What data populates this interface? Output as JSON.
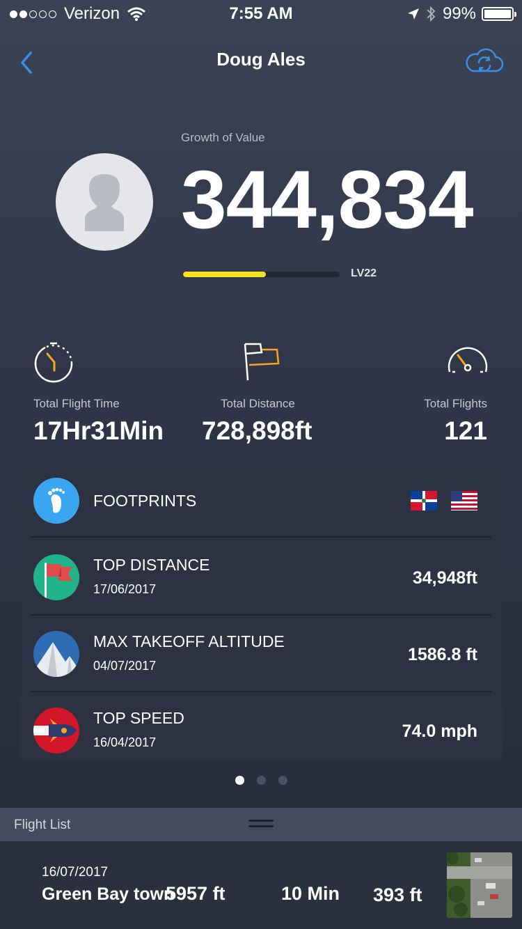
{
  "status_bar": {
    "carrier": "Verizon",
    "time": "7:55 AM",
    "battery": "99%"
  },
  "nav": {
    "title": "Doug Ales"
  },
  "profile": {
    "growth_label": "Growth of Value",
    "growth_value": "344,834",
    "level": "LV22",
    "level_progress": 0.53
  },
  "stats": [
    {
      "label": "Total Flight Time",
      "value": "17Hr31Min",
      "icon": "stopwatch-icon"
    },
    {
      "label": "Total Distance",
      "value": "728,898ft",
      "icon": "flag-icon"
    },
    {
      "label": "Total Flights",
      "value": "121",
      "icon": "speedometer-icon"
    }
  ],
  "records": {
    "footprints": {
      "label": "FOOTPRINTS",
      "flags": [
        "dominican-republic-flag",
        "usa-flag"
      ]
    },
    "items": [
      {
        "name": "TOP DISTANCE",
        "date": "17/06/2017",
        "value": "34,948ft",
        "icon": "red-flag-icon",
        "color": "#21b48a"
      },
      {
        "name": "MAX TAKEOFF ALTITUDE",
        "date": "04/07/2017",
        "value": "1586.8 ft",
        "icon": "mountain-icon",
        "color": "#2e6cb4"
      },
      {
        "name": "TOP SPEED",
        "date": "16/04/2017",
        "value": "74.0 mph",
        "icon": "rocket-icon",
        "color": "#d3172b"
      }
    ]
  },
  "pager": {
    "count": 3,
    "active": 0
  },
  "flight_list": {
    "header": "Flight List",
    "items": [
      {
        "date": "16/07/2017",
        "location": "Green Bay town",
        "altitude": "5957 ft",
        "duration": "10 Min",
        "distance": "393 ft"
      }
    ]
  },
  "colors": {
    "accent_blue": "#3a8ee6",
    "level_yellow": "#f5e31e",
    "stat_orange": "#f5a623"
  }
}
